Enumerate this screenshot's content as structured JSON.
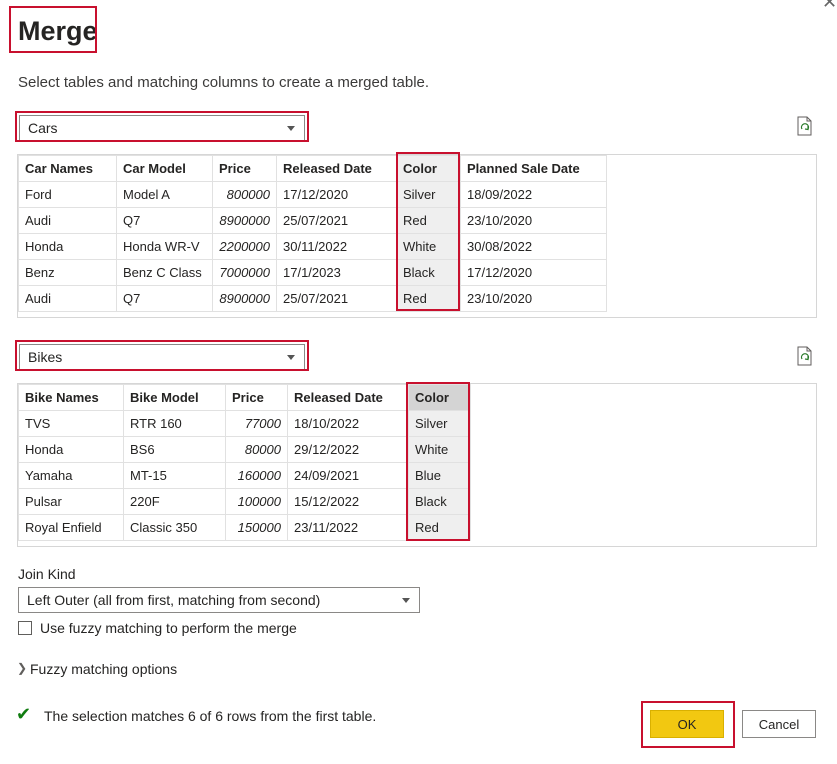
{
  "dialog": {
    "title": "Merge",
    "subtitle": "Select tables and matching columns to create a merged table."
  },
  "first_table": {
    "selected": "Cars",
    "columns": [
      "Car Names",
      "Car Model",
      "Price",
      "Released Date",
      "Color",
      "Planned Sale Date"
    ],
    "rows": [
      [
        "Ford",
        "Model A",
        "800000",
        "17/12/2020",
        "Silver",
        "18/09/2022"
      ],
      [
        "Audi",
        "Q7",
        "8900000",
        "25/07/2021",
        "Red",
        "23/10/2020"
      ],
      [
        "Honda",
        "Honda WR-V",
        "2200000",
        "30/11/2022",
        "White",
        "30/08/2022"
      ],
      [
        "Benz",
        "Benz C Class",
        "7000000",
        "17/1/2023",
        "Black",
        "17/12/2020"
      ],
      [
        "Audi",
        "Q7",
        "8900000",
        "25/07/2021",
        "Red",
        "23/10/2020"
      ]
    ],
    "selected_column": "Color"
  },
  "second_table": {
    "selected": "Bikes",
    "columns": [
      "Bike Names",
      "Bike Model",
      "Price",
      "Released Date",
      "Color"
    ],
    "rows": [
      [
        "TVS",
        "RTR 160",
        "77000",
        "18/10/2022",
        "Silver"
      ],
      [
        "Honda",
        "BS6",
        "80000",
        "29/12/2022",
        "White"
      ],
      [
        "Yamaha",
        "MT-15",
        "160000",
        "24/09/2021",
        "Blue"
      ],
      [
        "Pulsar",
        "220F",
        "100000",
        "15/12/2022",
        "Black"
      ],
      [
        "Royal Enfield",
        "Classic 350",
        "150000",
        "23/11/2022",
        "Red"
      ]
    ],
    "selected_column": "Color"
  },
  "join": {
    "label": "Join Kind",
    "selected": "Left Outer (all from first, matching from second)"
  },
  "fuzzy": {
    "checkbox_label": "Use fuzzy matching to perform the merge",
    "checked": false,
    "options_label": "Fuzzy matching options"
  },
  "status": {
    "text": "The selection matches 6 of 6 rows from the first table."
  },
  "buttons": {
    "ok": "OK",
    "cancel": "Cancel"
  },
  "colors": {
    "highlight": "#c8102e",
    "ok_button": "#f2c811",
    "check": "#107c10"
  },
  "icons": [
    "refresh-icon",
    "check-icon",
    "chevron-right-icon",
    "chevron-down-icon",
    "close-icon"
  ]
}
